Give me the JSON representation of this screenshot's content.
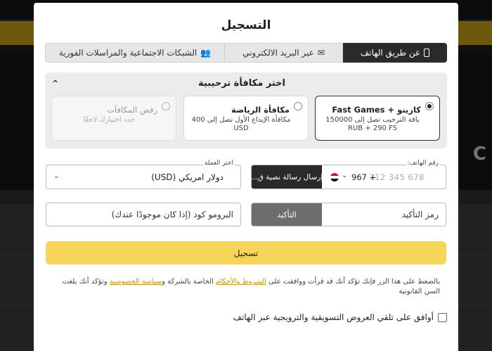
{
  "modal": {
    "title": "التسجيل"
  },
  "tabs": [
    {
      "label": "عن طريق الهاتف",
      "icon": "phone-icon",
      "active": true
    },
    {
      "label": "عبر البريد الالكتروني",
      "icon": "envelope-icon",
      "active": false
    },
    {
      "label": "الشبكات الاجتماعية والمراسلات الفورية",
      "icon": "users-icon",
      "active": false
    }
  ],
  "bonus": {
    "title": "اختر مكافأة ترحيبية",
    "options": [
      {
        "title": "كازينو + Fast Games",
        "desc": "باقة الترحيب تصل إلى 150000 RUB + 290 FS",
        "selected": true
      },
      {
        "title": "مكافأة الرياضة",
        "desc": "مكافأة الإيداع الأول تصل إلى 400 USD",
        "selected": false
      },
      {
        "title": "رفض المكافآت",
        "desc": "حدد اختيارك لاحقًا",
        "selected": false
      }
    ]
  },
  "phone": {
    "label": "رقم الهاتف:",
    "code": "967 +",
    "placeholder": "712 345 678",
    "sms_button": "إرسال رسالة نصية ق..."
  },
  "currency": {
    "label": "اختر العملة",
    "value": "دولار امريكي (USD)"
  },
  "confirm": {
    "placeholder": "رمز التأكيد",
    "button": "التأكيد"
  },
  "promo": {
    "placeholder": "البرومو كود (إذا كان موجودًا عندك)"
  },
  "register": {
    "label": "تسجيل"
  },
  "terms": {
    "prefix": "بالضغط على هذا الزر فإنك تؤكد أنك قد قرأت ووافقت على",
    "terms_link": "الشروط والأحكام",
    "middle": "الخاصة بالشركة و",
    "privacy_link": "سياسة الخصوصية",
    "suffix": "وتؤكد أنك بلغت السن القانونية"
  },
  "consent": {
    "label": "أوافق على تلقي العروض التسويقية والترويجية عبر الهاتف"
  },
  "background": {
    "hero_letter": "C"
  },
  "colors": {
    "accent": "#f7d45a",
    "dark": "#2a2a2a"
  }
}
